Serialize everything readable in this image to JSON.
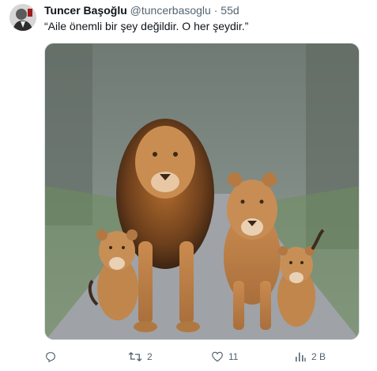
{
  "tweet": {
    "author_name": "Tuncer Başoğlu",
    "handle": "@tuncerbasoglu",
    "separator": "·",
    "time": "55d",
    "text": "“Aile önemli bir şey değildir. O her şeydir.”",
    "image_subject": "lion family walking on road"
  },
  "actions": {
    "reply_count": "",
    "retweet_count": "2",
    "like_count": "11",
    "views_count": "2 B"
  },
  "colors": {
    "text": "#0f1419",
    "secondary": "#536471",
    "background": "#ffffff"
  }
}
